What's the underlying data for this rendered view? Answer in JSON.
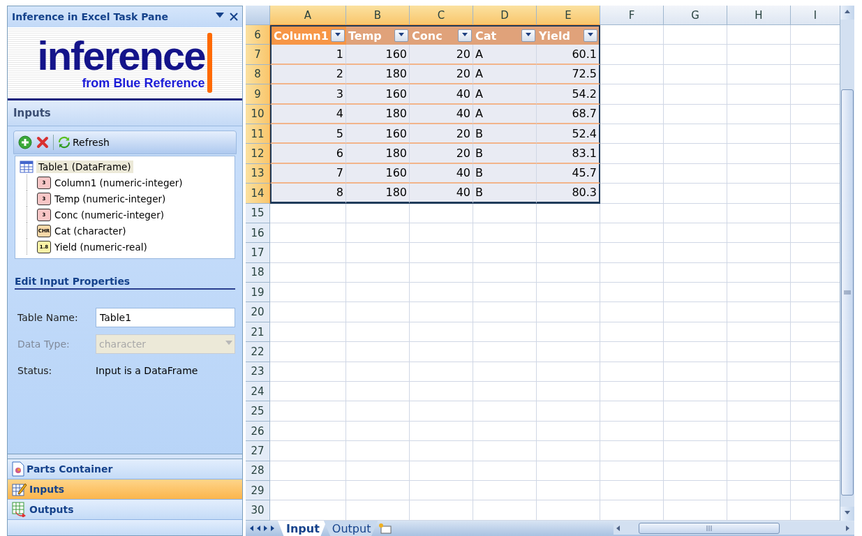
{
  "task_pane": {
    "title": "Inference in Excel Task Pane",
    "logo": {
      "name": "inference",
      "tagline": "from Blue Reference"
    },
    "section": "Inputs",
    "toolbar": {
      "refresh": "Refresh"
    },
    "tree": {
      "label": "Table1 (DataFrame)",
      "selected": true,
      "children": [
        {
          "label": "Column1 (numeric-integer)",
          "kind": "integer",
          "badge": "3"
        },
        {
          "label": "Temp (numeric-integer)",
          "kind": "integer",
          "badge": "3"
        },
        {
          "label": "Conc (numeric-integer)",
          "kind": "integer",
          "badge": "3"
        },
        {
          "label": "Cat (character)",
          "kind": "character",
          "badge": "CHR"
        },
        {
          "label": "Yield (numeric-real)",
          "kind": "real",
          "badge": "1.8"
        }
      ]
    },
    "properties": {
      "title": "Edit Input Properties",
      "fields": [
        {
          "label": "Table Name:",
          "kind": "input",
          "value": "Table1",
          "disabled": false
        },
        {
          "label": "Data Type:",
          "kind": "select",
          "value": "character",
          "disabled": true
        },
        {
          "label": "Status:",
          "kind": "text",
          "value": "Input is a DataFrame",
          "disabled": false
        }
      ]
    },
    "nav": [
      {
        "label": "Parts Container",
        "kind": "parts",
        "selected": false
      },
      {
        "label": "Inputs",
        "kind": "inputs",
        "selected": true
      },
      {
        "label": "Outputs",
        "kind": "outputs",
        "selected": false
      }
    ]
  },
  "sheet": {
    "columns": [
      {
        "label": "A",
        "selected": true
      },
      {
        "label": "B",
        "selected": true
      },
      {
        "label": "C",
        "selected": true
      },
      {
        "label": "D",
        "selected": true
      },
      {
        "label": "E",
        "selected": true
      },
      {
        "label": "F",
        "selected": false
      },
      {
        "label": "G",
        "selected": false
      },
      {
        "label": "H",
        "selected": false
      },
      {
        "label": "I",
        "selected": false
      }
    ],
    "table": {
      "fields": [
        {
          "name": "Column1",
          "numeric": true,
          "active": true
        },
        {
          "name": "Temp",
          "numeric": true,
          "active": false
        },
        {
          "name": "Conc",
          "numeric": true,
          "active": false
        },
        {
          "name": "Cat",
          "numeric": false,
          "active": false
        },
        {
          "name": "Yield",
          "numeric": true,
          "active": false
        }
      ]
    },
    "rows": [
      {
        "number": "6",
        "selected": true,
        "kind": "header"
      },
      {
        "number": "7",
        "selected": true,
        "kind": "data",
        "values": [
          "1",
          "160",
          "20",
          "A",
          "60.1"
        ]
      },
      {
        "number": "8",
        "selected": true,
        "kind": "data",
        "values": [
          "2",
          "180",
          "20",
          "A",
          "72.5"
        ]
      },
      {
        "number": "9",
        "selected": true,
        "kind": "data",
        "values": [
          "3",
          "160",
          "40",
          "A",
          "54.2"
        ]
      },
      {
        "number": "10",
        "selected": true,
        "kind": "data",
        "values": [
          "4",
          "180",
          "40",
          "A",
          "68.7"
        ]
      },
      {
        "number": "11",
        "selected": true,
        "kind": "data",
        "values": [
          "5",
          "160",
          "20",
          "B",
          "52.4"
        ]
      },
      {
        "number": "12",
        "selected": true,
        "kind": "data",
        "values": [
          "6",
          "180",
          "20",
          "B",
          "83.1"
        ]
      },
      {
        "number": "13",
        "selected": true,
        "kind": "data",
        "values": [
          "7",
          "160",
          "40",
          "B",
          "45.7"
        ]
      },
      {
        "number": "14",
        "selected": true,
        "kind": "data",
        "values": [
          "8",
          "180",
          "40",
          "B",
          "80.3"
        ]
      },
      {
        "number": "15",
        "selected": false,
        "kind": "blank"
      },
      {
        "number": "16",
        "selected": false,
        "kind": "blank"
      },
      {
        "number": "17",
        "selected": false,
        "kind": "blank"
      },
      {
        "number": "18",
        "selected": false,
        "kind": "blank"
      },
      {
        "number": "19",
        "selected": false,
        "kind": "blank"
      },
      {
        "number": "20",
        "selected": false,
        "kind": "blank"
      },
      {
        "number": "21",
        "selected": false,
        "kind": "blank"
      },
      {
        "number": "22",
        "selected": false,
        "kind": "blank"
      },
      {
        "number": "23",
        "selected": false,
        "kind": "blank"
      },
      {
        "number": "24",
        "selected": false,
        "kind": "blank"
      },
      {
        "number": "25",
        "selected": false,
        "kind": "blank"
      },
      {
        "number": "26",
        "selected": false,
        "kind": "blank"
      },
      {
        "number": "27",
        "selected": false,
        "kind": "blank"
      },
      {
        "number": "28",
        "selected": false,
        "kind": "blank"
      },
      {
        "number": "29",
        "selected": false,
        "kind": "blank"
      },
      {
        "number": "30",
        "selected": false,
        "kind": "blank"
      }
    ],
    "sheet_tabs": [
      {
        "label": "Input",
        "selected": true
      },
      {
        "label": "Output",
        "selected": false
      }
    ]
  }
}
